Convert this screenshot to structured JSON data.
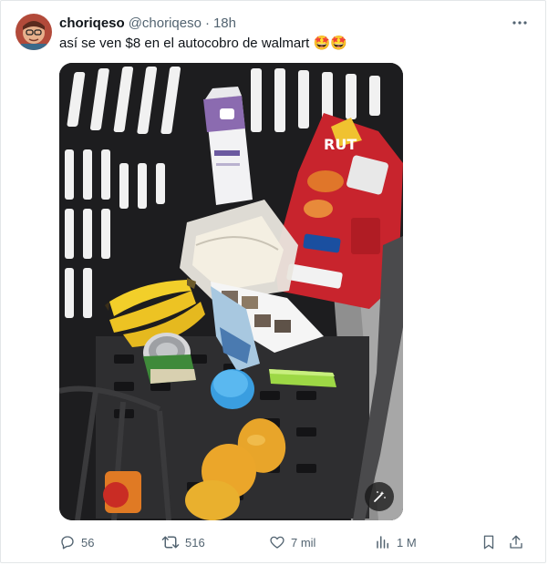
{
  "tweet": {
    "display_name": "choriqeso",
    "handle": "@choriqeso",
    "separator": "·",
    "time": "18h",
    "text": "así se ven $8 en el autocobro de walmart 🤩🤩"
  },
  "media": {
    "alt_icon": "magic-wand-icon"
  },
  "actions": {
    "replies": "56",
    "reposts": "516",
    "likes": "7 mil",
    "views": "1 M"
  },
  "colors": {
    "text_primary": "#0f1419",
    "text_secondary": "#536471",
    "border": "#e3e6e8"
  }
}
